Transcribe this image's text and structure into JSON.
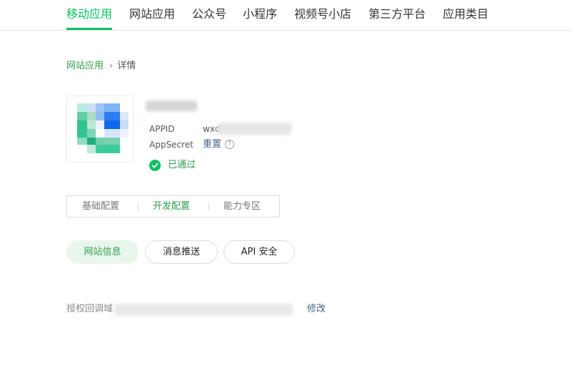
{
  "top_tabs": [
    {
      "label": "移动应用",
      "active": true
    },
    {
      "label": "网站应用",
      "active": false
    },
    {
      "label": "公众号",
      "active": false
    },
    {
      "label": "小程序",
      "active": false
    },
    {
      "label": "视频号小店",
      "active": false
    },
    {
      "label": "第三方平台",
      "active": false
    },
    {
      "label": "应用类目",
      "active": false
    }
  ],
  "breadcrumb": {
    "parent": "网站应用",
    "separator": "›",
    "current": "详情"
  },
  "app": {
    "appid_label": "APPID",
    "appid_value_visible": "wxd",
    "appsecret_label": "AppSecret",
    "reset_label": "重置",
    "help_glyph": "?",
    "status_text": "已通过",
    "status_icon": "check-circle-icon"
  },
  "config_tabs": [
    {
      "label": "基础配置",
      "active": false
    },
    {
      "label": "开发配置",
      "active": true
    },
    {
      "label": "能力专区",
      "active": false
    }
  ],
  "sub_tabs": [
    {
      "label": "网站信息",
      "active": true
    },
    {
      "label": "消息推送",
      "active": false
    },
    {
      "label": "API 安全",
      "active": false
    }
  ],
  "domain": {
    "label": "授权回调域",
    "edit_label": "修改"
  },
  "colors": {
    "accent": "#07c160",
    "link": "#4b5f8e"
  }
}
